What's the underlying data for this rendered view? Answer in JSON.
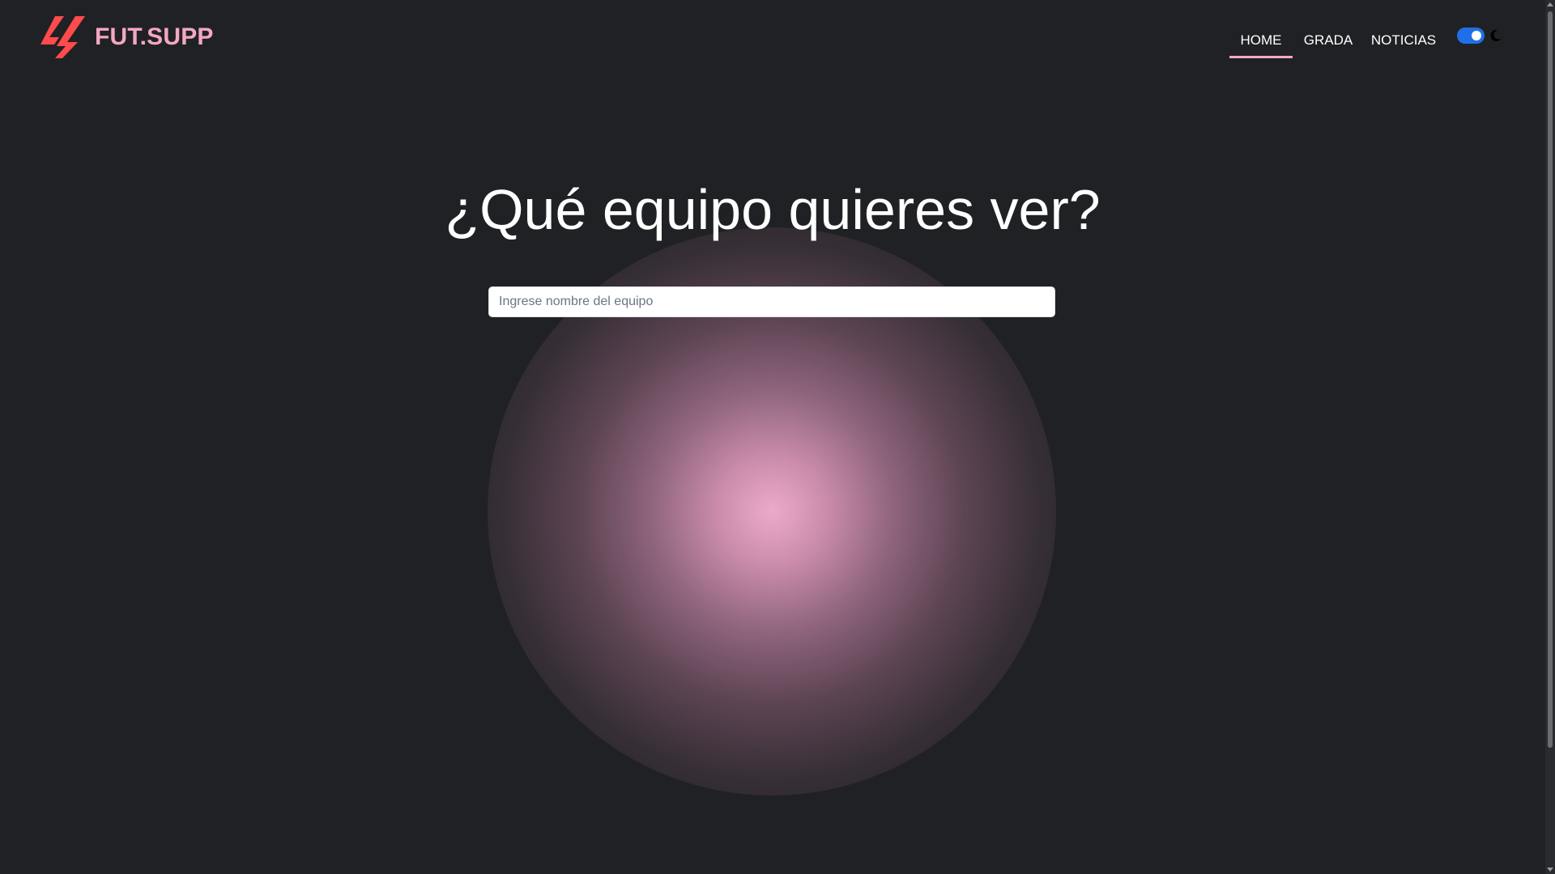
{
  "brand": {
    "name": "FUT.SUPP",
    "logo_icon": "laliga-style-logo-icon"
  },
  "nav": {
    "items": [
      {
        "label": "HOME",
        "active": true
      },
      {
        "label": "GRADA",
        "active": false
      },
      {
        "label": "NOTICIAS",
        "active": false
      }
    ],
    "theme_toggle": {
      "enabled": true,
      "icon": "moon-icon"
    }
  },
  "hero": {
    "title": "¿Qué equipo quieres ver?"
  },
  "search": {
    "placeholder": "Ingrese nombre del equipo",
    "value": ""
  },
  "colors": {
    "background": "#202124",
    "brand_pink": "#f4a7c3",
    "logo_red": "#ff4b4b",
    "toggle_blue": "#1f6fe8"
  }
}
